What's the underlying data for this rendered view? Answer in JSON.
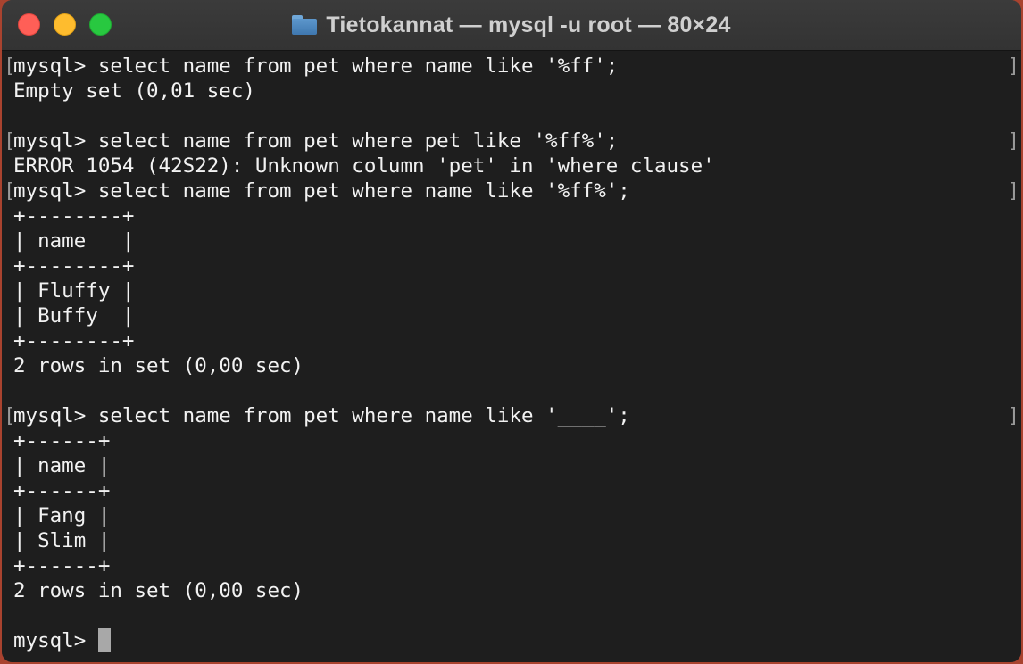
{
  "window": {
    "title": "Tietokannat — mysql -u root — 80×24",
    "title_icon": "folder-icon",
    "traffic_lights": {
      "close_color": "#ff5f57",
      "minimize_color": "#febc2e",
      "maximize_color": "#28c840"
    }
  },
  "terminal": {
    "background": "#1e1e1e",
    "foreground": "#f2f2f2",
    "mark_left": "[",
    "mark_right": "]",
    "lines": [
      "mysql> select name from pet where name like '%ff';",
      "Empty set (0,01 sec)",
      "",
      "mysql> select name from pet where pet like '%ff%';",
      "ERROR 1054 (42S22): Unknown column 'pet' in 'where clause'",
      "mysql> select name from pet where name like '%ff%';",
      "+--------+",
      "| name   |",
      "+--------+",
      "| Fluffy |",
      "| Buffy  |",
      "+--------+",
      "2 rows in set (0,00 sec)",
      "",
      "mysql> select name from pet where name like '____';",
      "+------+",
      "| name |",
      "+------+",
      "| Fang |",
      "| Slim |",
      "+------+",
      "2 rows in set (0,00 sec)",
      "",
      "mysql> "
    ]
  }
}
